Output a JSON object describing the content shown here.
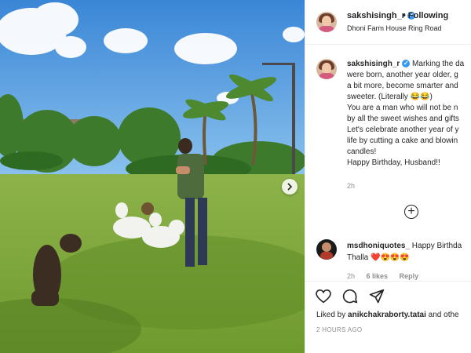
{
  "post": {
    "username": "sakshisingh_r",
    "follow_label": "• Following",
    "location": "Dhoni Farm House Ring Road",
    "caption_lines": [
      "Marking the da",
      "were born, another year older, g",
      "a bit more, become smarter and",
      "sweeter. (Literally 😂😂)",
      "You are a man who will not be n",
      "by all the sweet wishes and gifts",
      "Let's celebrate another year of y",
      "life by cutting a cake and blowin",
      "candles!",
      "Happy Birthday, Husband!!"
    ],
    "caption_time": "2h",
    "liked_by_prefix": "Liked by",
    "liked_by_user": "anikchakraborty.tatai",
    "liked_by_suffix": "and othe",
    "date": "2 HOURS AGO"
  },
  "comment": {
    "username": "msdhoniquotes_",
    "text_line1": "Happy Birthda",
    "text_line2": "Thalla ❤️😍😍😍",
    "time": "2h",
    "likes": "6 likes",
    "reply": "Reply"
  },
  "icons": {
    "verified": "verified-badge-icon",
    "like": "heart-icon",
    "comment": "comment-icon",
    "share": "paper-plane-icon",
    "more": "plus-circle-icon",
    "next": "chevron-right-icon"
  },
  "colors": {
    "verified_blue": "#3897f0",
    "muted_text": "#8e8e8e"
  }
}
